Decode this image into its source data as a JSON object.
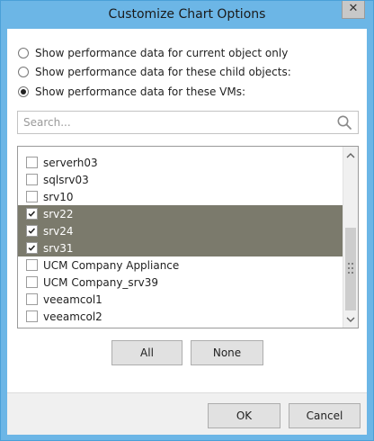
{
  "window": {
    "title": "Customize Chart Options",
    "close_glyph": "✕"
  },
  "options": [
    {
      "label": "Show performance data for current object only",
      "selected": false
    },
    {
      "label": "Show performance data for these child objects:",
      "selected": false
    },
    {
      "label": "Show performance data for these VMs:",
      "selected": true
    }
  ],
  "search": {
    "placeholder": "Search...",
    "value": "",
    "icon": "search-icon"
  },
  "vm_list": {
    "items": [
      {
        "label": "serverh03",
        "checked": false,
        "highlighted": false
      },
      {
        "label": "sqlsrv03",
        "checked": false,
        "highlighted": false
      },
      {
        "label": "srv10",
        "checked": false,
        "highlighted": false
      },
      {
        "label": "srv22",
        "checked": true,
        "highlighted": true
      },
      {
        "label": "srv24",
        "checked": true,
        "highlighted": true
      },
      {
        "label": "srv31",
        "checked": true,
        "highlighted": true
      },
      {
        "label": "UCM Company Appliance",
        "checked": false,
        "highlighted": false
      },
      {
        "label": "UCM Company_srv39",
        "checked": false,
        "highlighted": false
      },
      {
        "label": "veeamcol1",
        "checked": false,
        "highlighted": false
      },
      {
        "label": "veeamcol2",
        "checked": false,
        "highlighted": false
      }
    ]
  },
  "buttons": {
    "all": "All",
    "none": "None",
    "ok": "OK",
    "cancel": "Cancel"
  },
  "colors": {
    "title_bar": "#6cb6e6",
    "selection": "#7b7a6c",
    "button_face": "#e1e1e1"
  }
}
